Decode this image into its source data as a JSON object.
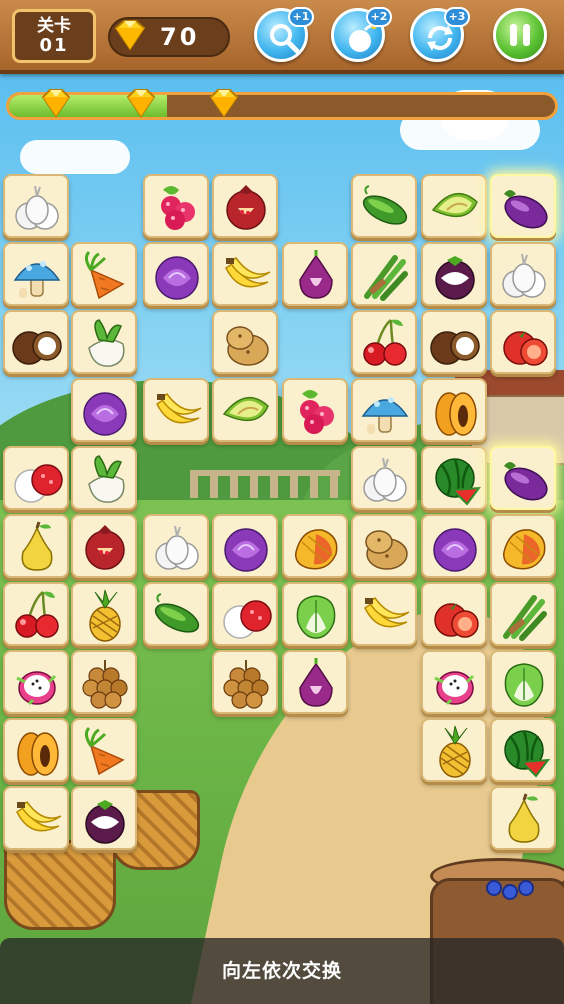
{
  "topbar": {
    "level_label": "关卡",
    "level_number": "01",
    "score": "70",
    "tools": [
      {
        "name": "hint",
        "icon": "magnifier-icon",
        "count": "+1"
      },
      {
        "name": "bomb",
        "icon": "bomb-icon",
        "count": "+2"
      },
      {
        "name": "shuffle",
        "icon": "shuffle-icon",
        "count": "+3"
      }
    ],
    "pause_icon": "pause-icon"
  },
  "progress": {
    "fraction": 0.29,
    "star_fractions": [
      0.09,
      0.245,
      0.395
    ],
    "star_icon": "diamond-icon"
  },
  "board": {
    "columns": 8,
    "rows": 10,
    "tiles": [
      {
        "row": 0,
        "col": 0,
        "fruit": "garlic"
      },
      {
        "row": 0,
        "col": 2,
        "fruit": "raspberry"
      },
      {
        "row": 0,
        "col": 3,
        "fruit": "pomegranate"
      },
      {
        "row": 0,
        "col": 5,
        "fruit": "cucumber"
      },
      {
        "row": 0,
        "col": 6,
        "fruit": "melon"
      },
      {
        "row": 0,
        "col": 7,
        "fruit": "eggplant",
        "selected": true
      },
      {
        "row": 1,
        "col": 0,
        "fruit": "mushroom"
      },
      {
        "row": 1,
        "col": 1,
        "fruit": "carrot"
      },
      {
        "row": 1,
        "col": 2,
        "fruit": "cabbage"
      },
      {
        "row": 1,
        "col": 3,
        "fruit": "banana"
      },
      {
        "row": 1,
        "col": 4,
        "fruit": "onion"
      },
      {
        "row": 1,
        "col": 5,
        "fruit": "asparagus"
      },
      {
        "row": 1,
        "col": 6,
        "fruit": "mangosteen"
      },
      {
        "row": 1,
        "col": 7,
        "fruit": "garlic"
      },
      {
        "row": 2,
        "col": 0,
        "fruit": "coconut"
      },
      {
        "row": 2,
        "col": 1,
        "fruit": "radish"
      },
      {
        "row": 2,
        "col": 3,
        "fruit": "potato"
      },
      {
        "row": 2,
        "col": 5,
        "fruit": "cherry"
      },
      {
        "row": 2,
        "col": 6,
        "fruit": "coconut"
      },
      {
        "row": 2,
        "col": 7,
        "fruit": "tomato"
      },
      {
        "row": 3,
        "col": 1,
        "fruit": "cabbage"
      },
      {
        "row": 3,
        "col": 2,
        "fruit": "banana"
      },
      {
        "row": 3,
        "col": 3,
        "fruit": "melon"
      },
      {
        "row": 3,
        "col": 4,
        "fruit": "raspberry"
      },
      {
        "row": 3,
        "col": 5,
        "fruit": "mushroom"
      },
      {
        "row": 3,
        "col": 6,
        "fruit": "papaya"
      },
      {
        "row": 4,
        "col": 0,
        "fruit": "lychee"
      },
      {
        "row": 4,
        "col": 1,
        "fruit": "radish"
      },
      {
        "row": 4,
        "col": 5,
        "fruit": "garlic"
      },
      {
        "row": 4,
        "col": 6,
        "fruit": "watermelon"
      },
      {
        "row": 4,
        "col": 7,
        "fruit": "eggplant",
        "selected": true
      },
      {
        "row": 5,
        "col": 0,
        "fruit": "pear"
      },
      {
        "row": 5,
        "col": 1,
        "fruit": "pomegranate"
      },
      {
        "row": 5,
        "col": 2,
        "fruit": "garlic"
      },
      {
        "row": 5,
        "col": 3,
        "fruit": "cabbage"
      },
      {
        "row": 5,
        "col": 4,
        "fruit": "mango"
      },
      {
        "row": 5,
        "col": 5,
        "fruit": "potato"
      },
      {
        "row": 5,
        "col": 6,
        "fruit": "cabbage"
      },
      {
        "row": 5,
        "col": 7,
        "fruit": "mango"
      },
      {
        "row": 6,
        "col": 0,
        "fruit": "cherry"
      },
      {
        "row": 6,
        "col": 1,
        "fruit": "pineapple"
      },
      {
        "row": 6,
        "col": 2,
        "fruit": "cucumber"
      },
      {
        "row": 6,
        "col": 3,
        "fruit": "lychee"
      },
      {
        "row": 6,
        "col": 4,
        "fruit": "bokchoy"
      },
      {
        "row": 6,
        "col": 5,
        "fruit": "banana"
      },
      {
        "row": 6,
        "col": 6,
        "fruit": "tomato"
      },
      {
        "row": 6,
        "col": 7,
        "fruit": "asparagus"
      },
      {
        "row": 7,
        "col": 0,
        "fruit": "dragonfruit"
      },
      {
        "row": 7,
        "col": 1,
        "fruit": "lychee-bunch"
      },
      {
        "row": 7,
        "col": 3,
        "fruit": "lychee-bunch"
      },
      {
        "row": 7,
        "col": 4,
        "fruit": "onion"
      },
      {
        "row": 7,
        "col": 6,
        "fruit": "dragonfruit"
      },
      {
        "row": 7,
        "col": 7,
        "fruit": "bokchoy"
      },
      {
        "row": 8,
        "col": 0,
        "fruit": "papaya"
      },
      {
        "row": 8,
        "col": 1,
        "fruit": "carrot"
      },
      {
        "row": 8,
        "col": 6,
        "fruit": "pineapple"
      },
      {
        "row": 8,
        "col": 7,
        "fruit": "watermelon"
      },
      {
        "row": 9,
        "col": 0,
        "fruit": "banana"
      },
      {
        "row": 9,
        "col": 1,
        "fruit": "mangosteen"
      },
      {
        "row": 9,
        "col": 7,
        "fruit": "pear"
      }
    ]
  },
  "hint_text": "向左依次交换"
}
